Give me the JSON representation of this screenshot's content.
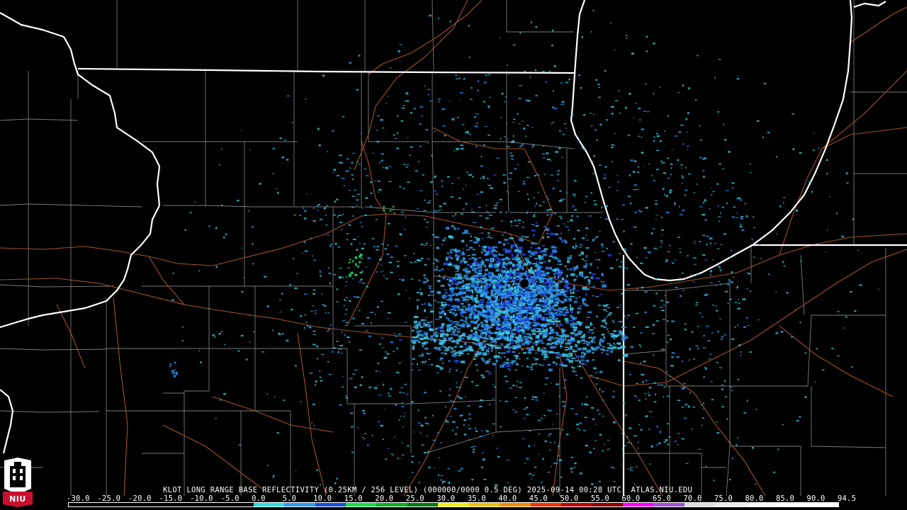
{
  "caption": {
    "text": "KLOT LONG RANGE BASE REFLECTIVITY (0.25KM / 256 LEVEL) (000000/0000 0.5 DEG) 2025-09-14 00:28 UTC  ATLAS.NIU.EDU"
  },
  "logo": {
    "text": "NIU",
    "color": "#c8102e"
  },
  "legend": {
    "labels": [
      "-30.0",
      "-25.0",
      "-20.0",
      "-15.0",
      "-10.0",
      "-5.0",
      "0.0",
      "5.0",
      "10.0",
      "15.0",
      "20.0",
      "25.0",
      "30.0",
      "35.0",
      "40.0",
      "45.0",
      "50.0",
      "55.0",
      "60.0",
      "65.0",
      "70.0",
      "75.0",
      "80.0",
      "85.0",
      "90.0",
      "94.5"
    ],
    "colors": [
      "#000000",
      "#000000",
      "#000000",
      "#000000",
      "#000000",
      "#000000",
      "#2ee0e0",
      "#2a9cf0",
      "#1b4fd8",
      "#10e040",
      "#08b020",
      "#067a12",
      "#f0f000",
      "#f0c000",
      "#f08c00",
      "#f03000",
      "#c80000",
      "#900000",
      "#ff00ff",
      "#a050d8",
      "#dcdcdc",
      "#ececec",
      "#f6f6f6",
      "#ffffff",
      "#ffffff"
    ]
  },
  "map": {
    "radar_site": "KLOT",
    "colors": {
      "state_border": "#ffffff",
      "county_line": "#7a7a7a",
      "road": "#a0522d",
      "echo_cyan": "#3cc8e0",
      "echo_blue": "#2a8ce8",
      "echo_dark_blue": "#2040d8",
      "echo_green": "#20d060"
    }
  }
}
